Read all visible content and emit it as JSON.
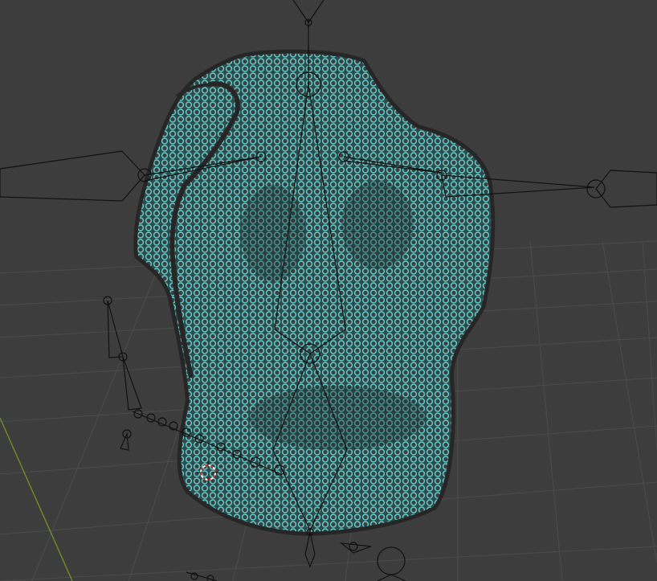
{
  "viewport": {
    "background_color": "#3d3d3d",
    "grid_color": "#4a4a4a",
    "x_axis_color": "#6a8a2a"
  },
  "mesh": {
    "fill_color": "#4fb3b3",
    "hole_color": "#2e3a3a",
    "edge_color": "#2b2b2b",
    "display": "wireframe-overlay"
  },
  "armature": {
    "line_color": "#111111"
  },
  "cursor_3d": {
    "icon": "3d-cursor-icon",
    "ring_color_a": "#cc3333",
    "ring_color_b": "#ffffff"
  }
}
